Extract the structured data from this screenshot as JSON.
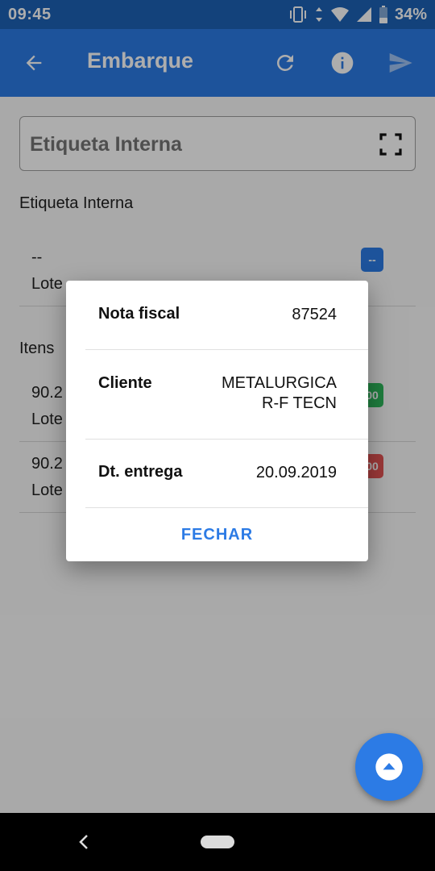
{
  "status_bar": {
    "time": "09:45",
    "battery": "34%",
    "icons": [
      "vibrate-icon",
      "data-arrows-icon",
      "wifi-icon",
      "signal-icon",
      "battery-icon"
    ]
  },
  "app_bar": {
    "title": "Embarque",
    "icons": [
      "arrow-back-icon",
      "refresh-icon",
      "info-icon",
      "send-icon"
    ]
  },
  "search": {
    "placeholder": "Etiqueta Interna",
    "icon": "scan-frame-icon"
  },
  "etiqueta_section": {
    "title": "Etiqueta Interna",
    "item": {
      "line1": "--",
      "line2": "Lote",
      "badge": "--",
      "badge_color": "#2c7be5"
    }
  },
  "itens_section": {
    "title": "Itens",
    "items": [
      {
        "line1": "90.2",
        "line2": "Lote",
        "badge": "00",
        "badge_color": "#2eb85c"
      },
      {
        "line1": "90.2",
        "line2": "Lote",
        "badge": "00",
        "badge_color": "#e55353"
      }
    ]
  },
  "dialog": {
    "rows": [
      {
        "label": "Nota fiscal",
        "value": "87524"
      },
      {
        "label": "Cliente",
        "value_lines": [
          "METALURGICA",
          "R-F TECN"
        ]
      },
      {
        "label": "Dt. entrega",
        "value": "20.09.2019"
      }
    ],
    "close_label": "FECHAR"
  },
  "fab": {
    "icon": "eject-icon"
  },
  "nav_bar": {
    "icons": [
      "nav-back-icon",
      "home-pill-icon"
    ]
  },
  "colors": {
    "primary": "#2c7be5",
    "status_bar": "#1c62b5",
    "success": "#2eb85c",
    "danger": "#e55353"
  }
}
